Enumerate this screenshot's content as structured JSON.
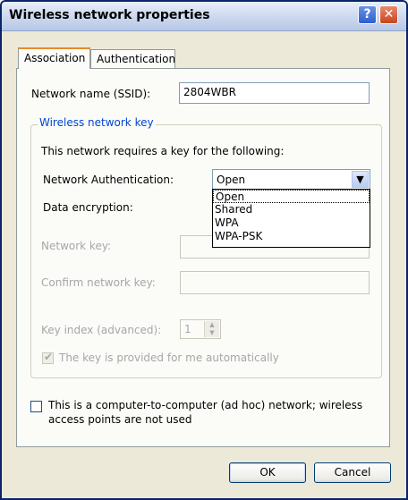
{
  "window": {
    "title": "Wireless network properties",
    "help_glyph": "?",
    "close_glyph": "✕"
  },
  "tabs": [
    {
      "label": "Association",
      "active": true
    },
    {
      "label": "Authentication",
      "active": false
    }
  ],
  "association": {
    "ssid_label": "Network name (SSID):",
    "ssid_value": "2804WBR",
    "group_title": "Wireless network key",
    "key_required_text": "This network requires a key for the following:",
    "auth_label": "Network Authentication:",
    "auth_selected": "Open",
    "auth_options": [
      "Open",
      "Shared",
      "WPA",
      "WPA-PSK"
    ],
    "encryption_label": "Data encryption:",
    "network_key_label": "Network key:",
    "confirm_key_label": "Confirm network key:",
    "key_index_label": "Key index (advanced):",
    "key_index_value": "1",
    "auto_key_label": "The key is provided for me automatically",
    "adhoc_label_line1": "This is a computer-to-computer (ad hoc) network; wireless",
    "adhoc_label_line2": "access points are not used"
  },
  "buttons": {
    "ok": "OK",
    "cancel": "Cancel"
  },
  "icons": {
    "dropdown": "chevron-down-icon",
    "spin_up": "triangle-up-icon",
    "spin_down": "triangle-down-icon",
    "check": "checkmark-icon"
  }
}
